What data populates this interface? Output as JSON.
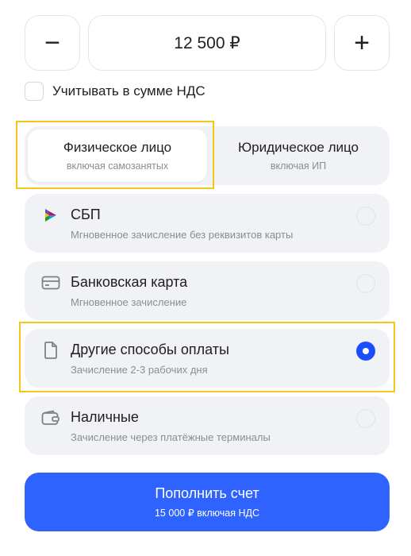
{
  "amount": {
    "minus_label": "−",
    "value": "12 500 ₽",
    "plus_label": "+"
  },
  "vat": {
    "label": "Учитывать в сумме НДС",
    "checked": false
  },
  "payer_type": {
    "options": [
      {
        "title": "Физическое лицо",
        "subtitle": "включая самозанятых",
        "selected": true
      },
      {
        "title": "Юридическое лицо",
        "subtitle": "включая ИП",
        "selected": false
      }
    ]
  },
  "payment_methods": [
    {
      "icon": "sbp-icon",
      "title": "СБП",
      "subtitle": "Мгновенное зачисление без реквизитов карты",
      "selected": false
    },
    {
      "icon": "bank-card-icon",
      "title": "Банковская карта",
      "subtitle": "Мгновенное зачисление",
      "selected": false
    },
    {
      "icon": "document-icon",
      "title": "Другие способы оплаты",
      "subtitle": "Зачисление 2-3 рабочих дня",
      "selected": true
    },
    {
      "icon": "wallet-icon",
      "title": "Наличные",
      "subtitle": "Зачисление через платёжные терминалы",
      "selected": false
    }
  ],
  "submit": {
    "label": "Пополнить счет",
    "sublabel": "15 000 ₽ включая НДС"
  },
  "colors": {
    "accent": "#2f63ff",
    "radio_selected": "#1a4dff",
    "highlight": "#f5c518",
    "option_bg": "#f1f2f5"
  }
}
